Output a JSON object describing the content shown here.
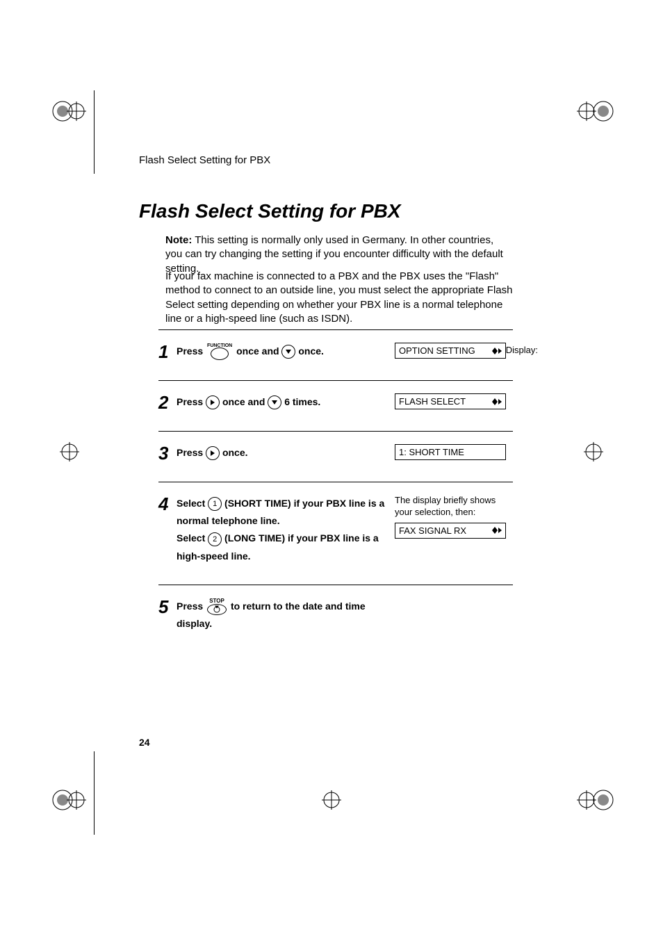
{
  "running_head": "Flash Select Setting for PBX",
  "section_title": "Flash Select Setting for PBX",
  "note_label": "Note:",
  "note_text": " This setting is normally only used in Germany. In other countries, you can try changing the setting if you encounter difficulty with the default setting.",
  "intro_text": "If your fax machine is connected to a PBX and the PBX uses the \"Flash\" method to connect to an outside line, you must select the appropriate Flash Select setting depending on whether your PBX line is a normal telephone line or a high-speed line (such as ISDN).",
  "display_label": "Display:",
  "steps": {
    "s1": {
      "num": "1",
      "press": "Press ",
      "func_label": "FUNCTION",
      "mid": " once and ",
      "tail": " once.",
      "lcd": "OPTION SETTING"
    },
    "s2": {
      "num": "2",
      "press": "Press ",
      "mid": " once and ",
      "tail": " 6 times.",
      "lcd": "FLASH SELECT"
    },
    "s3": {
      "num": "3",
      "press": "Press ",
      "tail": " once.",
      "lcd": "1: SHORT TIME"
    },
    "s4": {
      "num": "4",
      "select1a": "Select ",
      "select1b": " (SHORT TIME) if your PBX line is a normal telephone line.",
      "select2a": "Select ",
      "select2b": " (LONG TIME) if your PBX line is a high-speed line.",
      "key1": "1",
      "key2": "2",
      "brief": "The display briefly shows your selection, then:",
      "lcd": "FAX SIGNAL RX"
    },
    "s5": {
      "num": "5",
      "press": "Press ",
      "stop_label": "STOP",
      "tail": " to return to the date and time display."
    }
  },
  "page_number": "24"
}
